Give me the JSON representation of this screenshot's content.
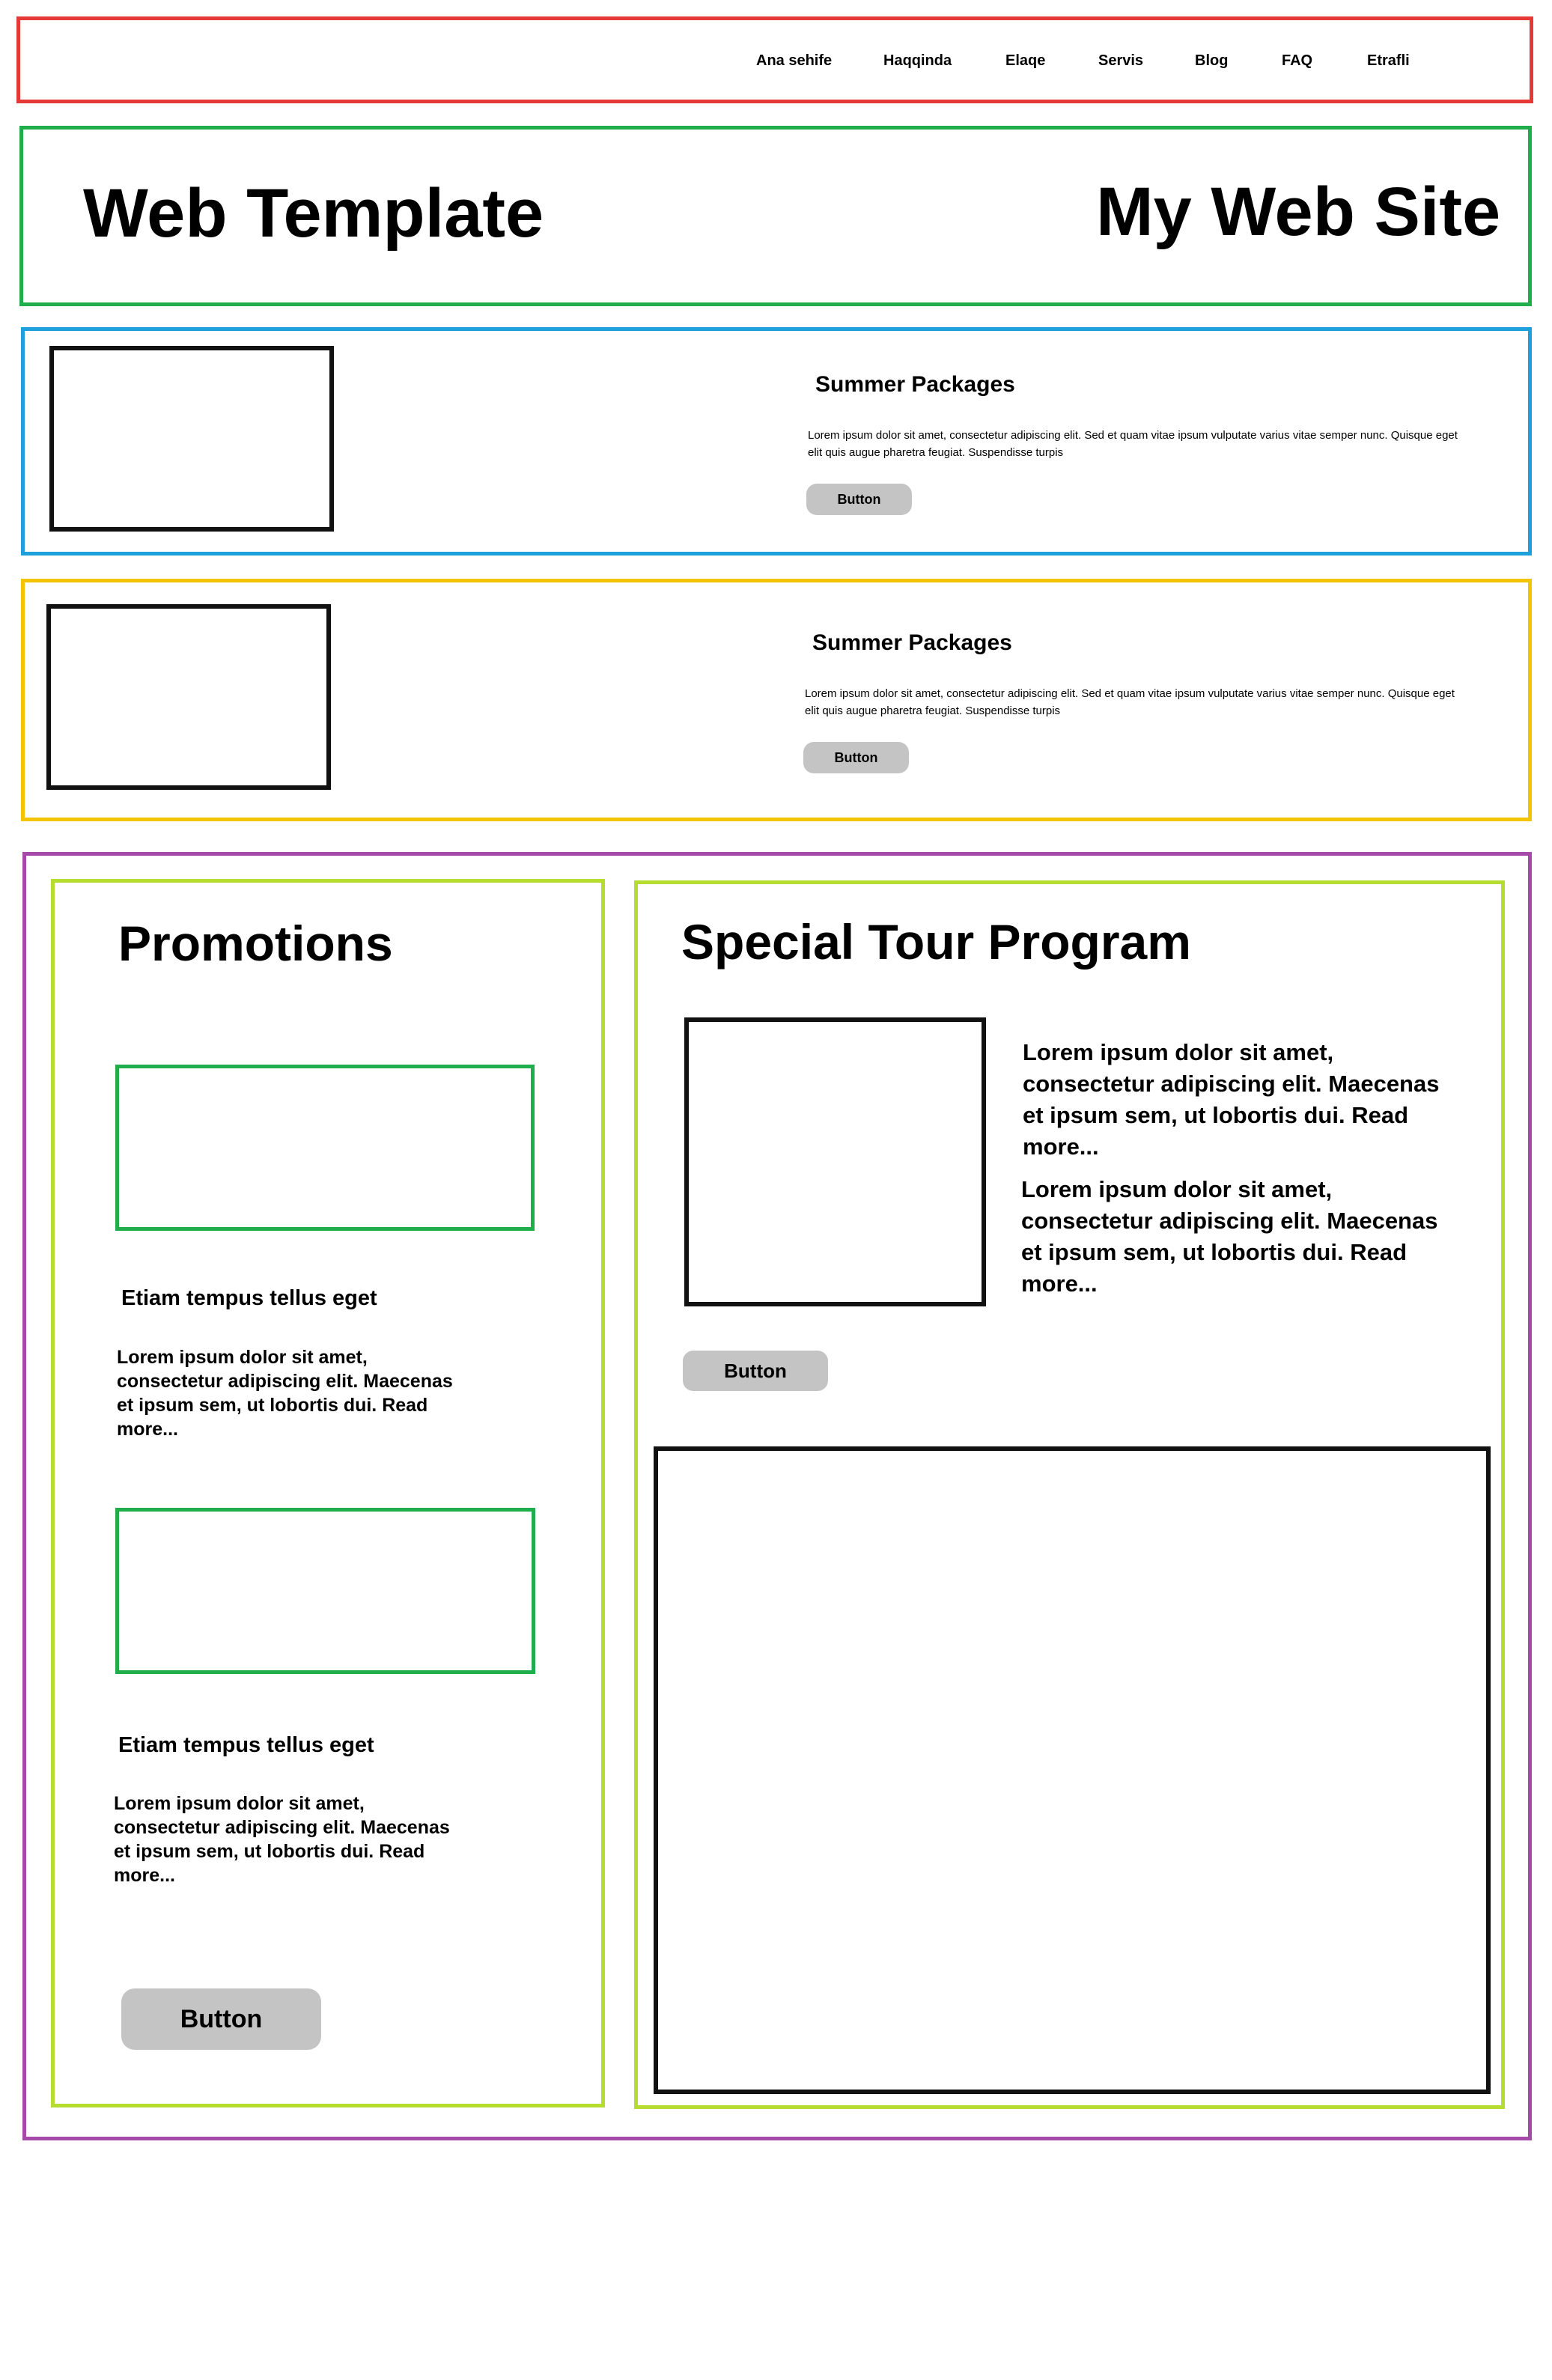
{
  "nav": {
    "items": [
      "Ana sehife",
      "Haqqinda",
      "Elaqe",
      "Servis",
      "Blog",
      "FAQ",
      "Etrafli"
    ]
  },
  "header": {
    "left_title": "Web Template",
    "right_title": "My Web Site"
  },
  "packages": [
    {
      "title": "Summer Packages",
      "text": "Lorem ipsum dolor sit amet, consectetur adipiscing elit. Sed et quam vitae ipsum vulputate varius vitae semper nunc. Quisque eget elit quis augue pharetra feugiat. Suspendisse turpis",
      "button": "Button"
    },
    {
      "title": "Summer Packages",
      "text": "Lorem ipsum dolor sit amet, consectetur adipiscing elit. Sed et quam vitae ipsum vulputate varius vitae semper nunc. Quisque eget elit quis augue pharetra feugiat. Suspendisse turpis",
      "button": "Button"
    }
  ],
  "promotions": {
    "title": "Promotions",
    "items": [
      {
        "heading": "Etiam tempus tellus eget",
        "text": "Lorem ipsum dolor sit amet, consectetur adipiscing elit. Maecenas et ipsum sem, ut lobortis dui. Read more..."
      },
      {
        "heading": "Etiam tempus tellus eget",
        "text": "Lorem ipsum dolor sit amet, consectetur adipiscing elit. Maecenas et ipsum sem, ut lobortis dui. Read more..."
      }
    ],
    "button": "Button"
  },
  "special": {
    "title": "Special Tour Program",
    "paragraphs": [
      "Lorem ipsum dolor sit amet, consectetur adipiscing elit. Maecenas et ipsum sem, ut lobortis dui. Read more...",
      "Lorem ipsum dolor sit amet, consectetur adipiscing elit. Maecenas et ipsum sem, ut lobortis dui. Read more..."
    ],
    "button": "Button"
  },
  "colors": {
    "nav_border": "#e53935",
    "header_border": "#1fae4b",
    "package1_border": "#1ea0dc",
    "package2_border": "#f2c500",
    "content_border": "#a54aa8",
    "column_border": "#b5dd2f",
    "button_bg": "#c4c4c4"
  }
}
